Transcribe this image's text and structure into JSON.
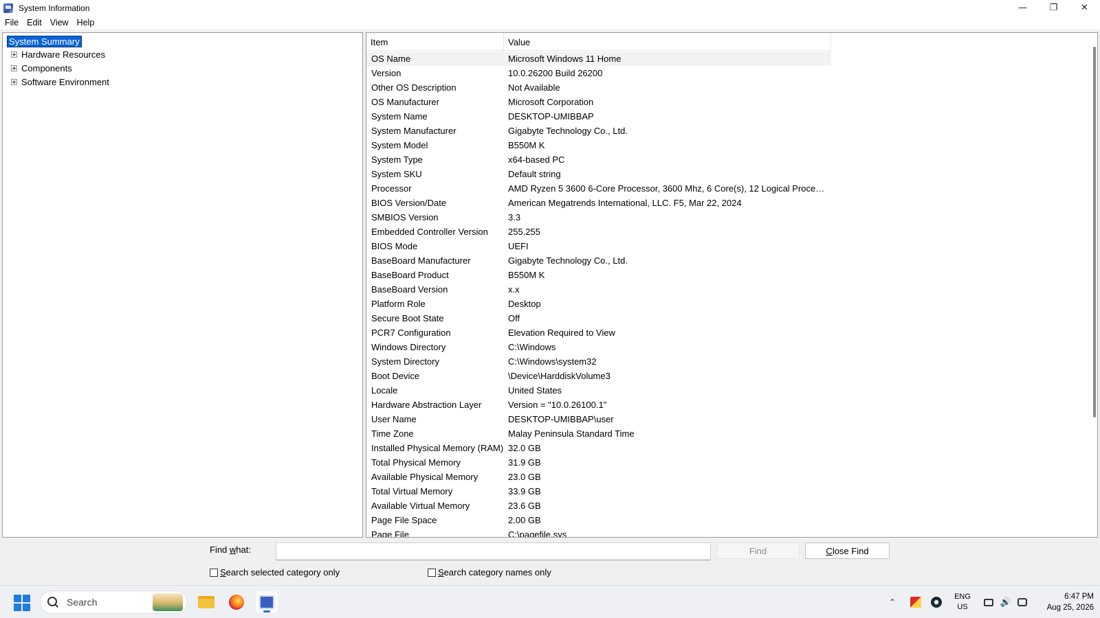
{
  "window": {
    "title": "System Information",
    "controls": {
      "minimize": "—",
      "maximize": "❐",
      "close": "✕"
    }
  },
  "menu": [
    "File",
    "Edit",
    "View",
    "Help"
  ],
  "tree": {
    "root": "System Summary",
    "children": [
      "Hardware Resources",
      "Components",
      "Software Environment"
    ]
  },
  "list": {
    "columns": {
      "item": "Item",
      "value": "Value"
    },
    "rows": [
      {
        "item": "OS Name",
        "value": "Microsoft Windows 11 Home"
      },
      {
        "item": "Version",
        "value": "10.0.26200 Build 26200"
      },
      {
        "item": "Other OS Description",
        "value": "Not Available"
      },
      {
        "item": "OS Manufacturer",
        "value": "Microsoft Corporation"
      },
      {
        "item": "System Name",
        "value": "DESKTOP-UMIBBAP"
      },
      {
        "item": "System Manufacturer",
        "value": "Gigabyte Technology Co., Ltd."
      },
      {
        "item": "System Model",
        "value": "B550M K"
      },
      {
        "item": "System Type",
        "value": "x64-based PC"
      },
      {
        "item": "System SKU",
        "value": "Default string"
      },
      {
        "item": "Processor",
        "value": "AMD Ryzen 5 3600 6-Core Processor, 3600 Mhz, 6 Core(s), 12 Logical Proces..."
      },
      {
        "item": "BIOS Version/Date",
        "value": "American Megatrends International, LLC. F5, Mar 22, 2024"
      },
      {
        "item": "SMBIOS Version",
        "value": "3.3"
      },
      {
        "item": "Embedded Controller Version",
        "value": "255.255"
      },
      {
        "item": "BIOS Mode",
        "value": "UEFI"
      },
      {
        "item": "BaseBoard Manufacturer",
        "value": "Gigabyte Technology Co., Ltd."
      },
      {
        "item": "BaseBoard Product",
        "value": "B550M K"
      },
      {
        "item": "BaseBoard Version",
        "value": "x.x"
      },
      {
        "item": "Platform Role",
        "value": "Desktop"
      },
      {
        "item": "Secure Boot State",
        "value": "Off"
      },
      {
        "item": "PCR7 Configuration",
        "value": "Elevation Required to View"
      },
      {
        "item": "Windows Directory",
        "value": "C:\\Windows"
      },
      {
        "item": "System Directory",
        "value": "C:\\Windows\\system32"
      },
      {
        "item": "Boot Device",
        "value": "\\Device\\HarddiskVolume3"
      },
      {
        "item": "Locale",
        "value": "United States"
      },
      {
        "item": "Hardware Abstraction Layer",
        "value": "Version = \"10.0.26100.1\""
      },
      {
        "item": "User Name",
        "value": "DESKTOP-UMIBBAP\\user"
      },
      {
        "item": "Time Zone",
        "value": "Malay Peninsula Standard Time"
      },
      {
        "item": "Installed Physical Memory (RAM)",
        "value": "32.0 GB"
      },
      {
        "item": "Total Physical Memory",
        "value": "31.9 GB"
      },
      {
        "item": "Available Physical Memory",
        "value": "23.0 GB"
      },
      {
        "item": "Total Virtual Memory",
        "value": "33.9 GB"
      },
      {
        "item": "Available Virtual Memory",
        "value": "23.6 GB"
      },
      {
        "item": "Page File Space",
        "value": "2.00 GB"
      },
      {
        "item": "Page File",
        "value": "C:\\pagefile.sys"
      }
    ]
  },
  "find": {
    "label_pre": "Find ",
    "label_ul": "w",
    "label_post": "hat:",
    "value": "",
    "find_button": "Find",
    "close_ul": "C",
    "close_rest": "lose Find",
    "chk_selected_ul": "S",
    "chk_selected_rest": "earch selected category only",
    "chk_names_ul": "S",
    "chk_names_rest": "earch category names only"
  },
  "taskbar": {
    "search_placeholder": "Search",
    "lang_line1": "ENG",
    "lang_line2": "US",
    "time": "6:47 PM",
    "date": "Aug 25, 2026"
  },
  "colors": {
    "selection": "#0a64d8",
    "accent": "#1f6fd0"
  }
}
